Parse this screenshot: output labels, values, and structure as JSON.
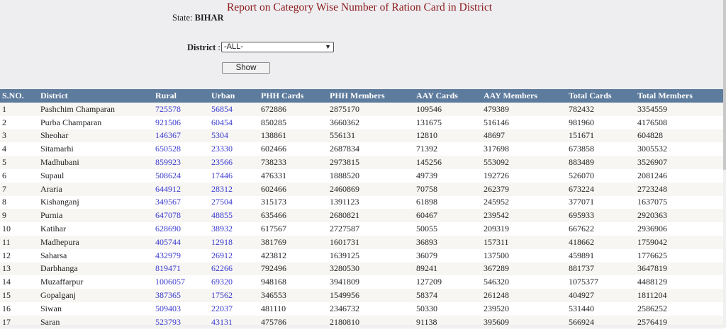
{
  "header": {
    "title": "Report on Category Wise Number of Ration Card in District",
    "state_label": "State:",
    "state_value": "BIHAR",
    "district_label": "District",
    "district_sep": ":",
    "district_selected": "-ALL-",
    "show_label": "Show"
  },
  "table": {
    "columns": [
      "S.NO.",
      "District",
      "Rural",
      "Urban",
      "PHH Cards",
      "PHH Members",
      "AAY Cards",
      "AAY Members",
      "Total Cards",
      "Total Members"
    ],
    "rows": [
      [
        "1",
        "Pashchim Champaran",
        "725578",
        "56854",
        "672886",
        "2875170",
        "109546",
        "479389",
        "782432",
        "3354559"
      ],
      [
        "2",
        "Purba Champaran",
        "921506",
        "60454",
        "850285",
        "3660362",
        "131675",
        "516146",
        "981960",
        "4176508"
      ],
      [
        "3",
        "Sheohar",
        "146367",
        "5304",
        "138861",
        "556131",
        "12810",
        "48697",
        "151671",
        "604828"
      ],
      [
        "4",
        "Sitamarhi",
        "650528",
        "23330",
        "602466",
        "2687834",
        "71392",
        "317698",
        "673858",
        "3005532"
      ],
      [
        "5",
        "Madhubani",
        "859923",
        "23566",
        "738233",
        "2973815",
        "145256",
        "553092",
        "883489",
        "3526907"
      ],
      [
        "6",
        "Supaul",
        "508624",
        "17446",
        "476331",
        "1888520",
        "49739",
        "192726",
        "526070",
        "2081246"
      ],
      [
        "7",
        "Araria",
        "644912",
        "28312",
        "602466",
        "2460869",
        "70758",
        "262379",
        "673224",
        "2723248"
      ],
      [
        "8",
        "Kishanganj",
        "349567",
        "27504",
        "315173",
        "1391123",
        "61898",
        "245952",
        "377071",
        "1637075"
      ],
      [
        "9",
        "Purnia",
        "647078",
        "48855",
        "635466",
        "2680821",
        "60467",
        "239542",
        "695933",
        "2920363"
      ],
      [
        "10",
        "Katihar",
        "628690",
        "38932",
        "617567",
        "2727587",
        "50055",
        "209319",
        "667622",
        "2936906"
      ],
      [
        "11",
        "Madhepura",
        "405744",
        "12918",
        "381769",
        "1601731",
        "36893",
        "157311",
        "418662",
        "1759042"
      ],
      [
        "12",
        "Saharsa",
        "432979",
        "26912",
        "423812",
        "1639125",
        "36079",
        "137500",
        "459891",
        "1776625"
      ],
      [
        "13",
        "Darbhanga",
        "819471",
        "62266",
        "792496",
        "3280530",
        "89241",
        "367289",
        "881737",
        "3647819"
      ],
      [
        "14",
        "Muzaffarpur",
        "1006057",
        "69320",
        "948168",
        "3941809",
        "127209",
        "546320",
        "1075377",
        "4488129"
      ],
      [
        "15",
        "Gopalganj",
        "387365",
        "17562",
        "346553",
        "1549956",
        "58374",
        "261248",
        "404927",
        "1811204"
      ],
      [
        "16",
        "Siwan",
        "509403",
        "22037",
        "481110",
        "2346732",
        "50330",
        "239520",
        "531440",
        "2586252"
      ],
      [
        "17",
        "Saran",
        "523793",
        "43131",
        "475786",
        "2180810",
        "91138",
        "395609",
        "566924",
        "2576419"
      ]
    ]
  },
  "colors": {
    "header_bg": "#5d7b9d",
    "title_color": "#8b1a1a",
    "link_color": "#3a3ad0",
    "row_alt": "#f7f6f3"
  }
}
